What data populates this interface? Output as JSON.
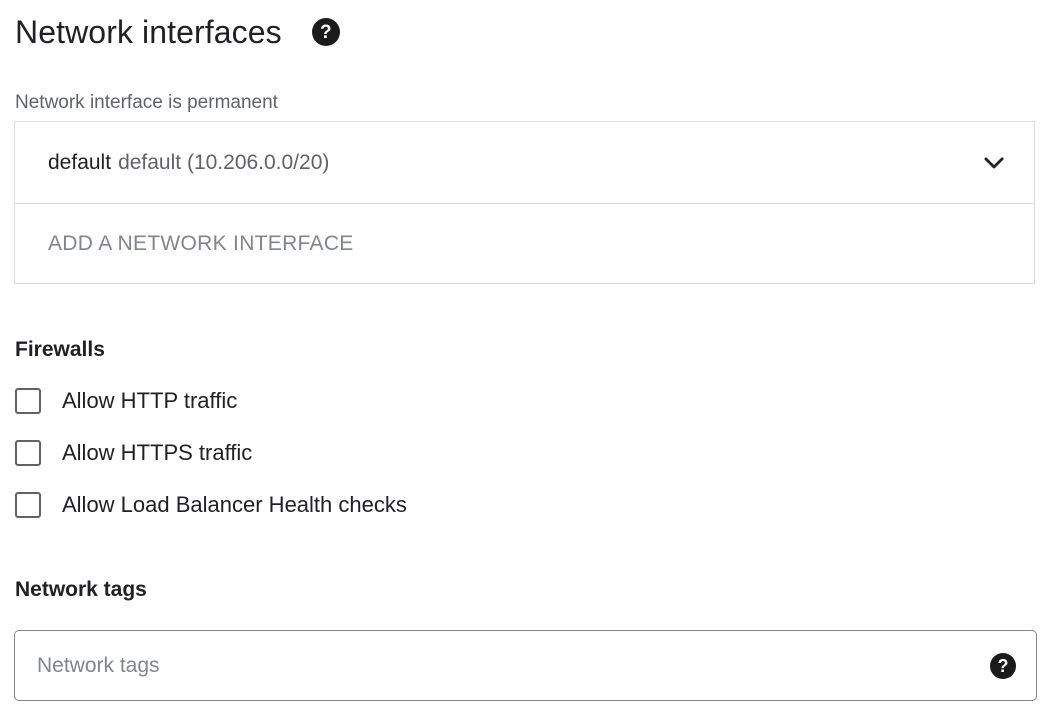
{
  "header": {
    "title": "Network interfaces",
    "help_icon": "?"
  },
  "network_interface": {
    "caption": "Network interface is permanent",
    "name": "default",
    "detail": "default (10.206.0.0/20)",
    "expand_icon": "chevron-down-icon",
    "add_label": "ADD A NETWORK INTERFACE"
  },
  "firewalls": {
    "heading": "Firewalls",
    "options": [
      {
        "label": "Allow HTTP traffic",
        "checked": false
      },
      {
        "label": "Allow HTTPS traffic",
        "checked": false
      },
      {
        "label": "Allow Load Balancer Health checks",
        "checked": false
      }
    ]
  },
  "network_tags": {
    "heading": "Network tags",
    "placeholder": "Network tags",
    "value": "",
    "help_icon": "?"
  }
}
